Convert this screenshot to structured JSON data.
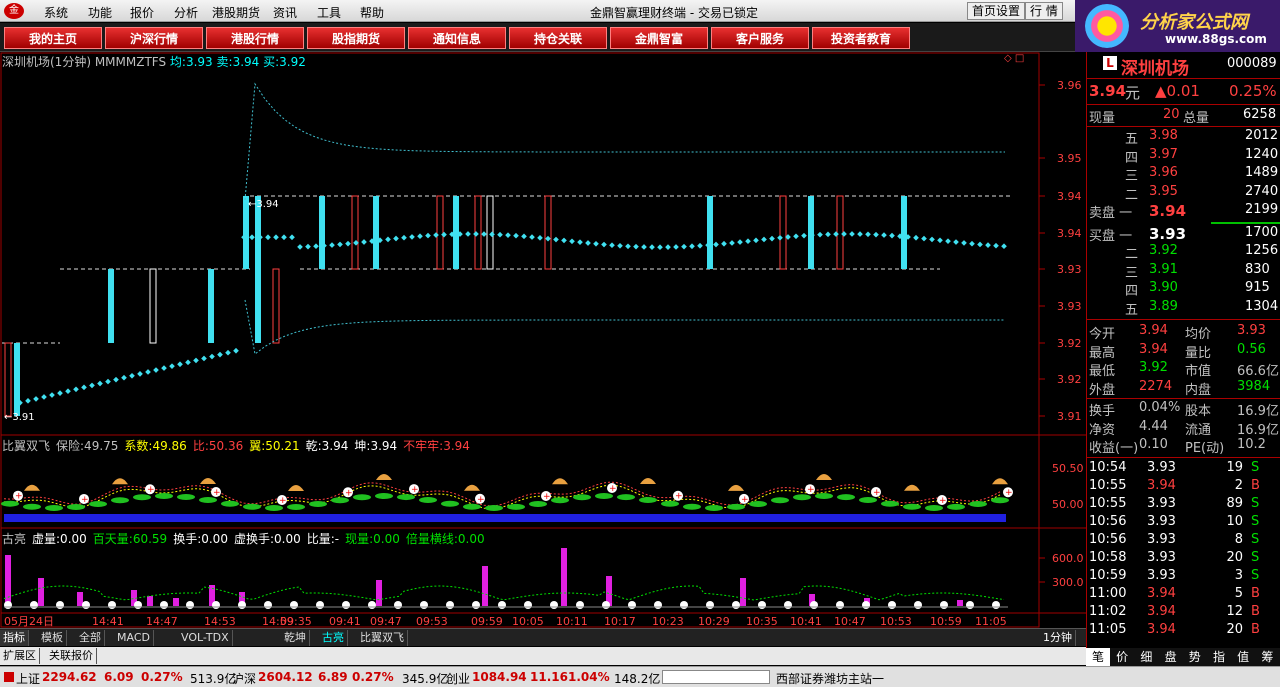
{
  "menu": {
    "items": [
      "系统",
      "功能",
      "报价",
      "分析",
      "港股期货",
      "资讯",
      "工具",
      "帮助"
    ],
    "title": "金鼎智赢理财终端 - 交易已锁定",
    "btn_home": "首页设置",
    "btn_quote": "行 情"
  },
  "ad": {
    "title": "分析家公式网",
    "url": "www.88gs.com"
  },
  "tabs": [
    "我的主页",
    "沪深行情",
    "港股行情",
    "股指期货",
    "通知信息",
    "持仓关联",
    "金鼎智富",
    "客户服务",
    "投资者教育"
  ],
  "chart_header": {
    "name": "深圳机场(1分钟) MMMMZTFS",
    "avg_label": "均:",
    "avg": "3.93",
    "sell_label": "卖:",
    "sell": "3.94",
    "buy_label": "买:",
    "buy": "3.92"
  },
  "price_axis": [
    "3.96",
    "3.95",
    "3.94",
    "3.94",
    "3.93",
    "3.93",
    "3.92",
    "3.92",
    "3.91"
  ],
  "annotations": {
    "high": "3.94",
    "low": "3.91"
  },
  "ind1": {
    "name": "比翼双飞",
    "items": [
      {
        "label": "保险:",
        "value": "49.75",
        "color": "#c0c0c0"
      },
      {
        "label": "系数:",
        "value": "49.86",
        "color": "#ffff00"
      },
      {
        "label": "比:",
        "value": "50.36",
        "color": "#ff4040"
      },
      {
        "label": "翼:",
        "value": "50.21",
        "color": "#ffff00"
      },
      {
        "label": "乾:",
        "value": "3.94",
        "color": "#fff"
      },
      {
        "label": "坤:",
        "value": "3.94",
        "color": "#fff"
      },
      {
        "label": "不牢牢:",
        "value": "3.94",
        "color": "#ff4040"
      }
    ],
    "axis": [
      "50.50",
      "50.00"
    ]
  },
  "ind2": {
    "name": "古亮",
    "items": [
      {
        "label": "虚量:",
        "value": "0.00",
        "color": "#fff"
      },
      {
        "label": "百天量:",
        "value": "60.59",
        "color": "#00e000"
      },
      {
        "label": "换手:",
        "value": "0.00",
        "color": "#fff"
      },
      {
        "label": "虚换手:",
        "value": "0.00",
        "color": "#fff"
      },
      {
        "label": "比量:",
        "value": "-",
        "color": "#fff"
      },
      {
        "label": "现量:",
        "value": "0.00",
        "color": "#00e000"
      },
      {
        "label": "倍量横线:",
        "value": "0.00",
        "color": "#00e000"
      }
    ],
    "axis": [
      "600.0",
      "300.0"
    ]
  },
  "time_axis": [
    "05月24日",
    "14:41",
    "14:47",
    "14:53",
    "14:59",
    "09:35",
    "09:41",
    "09:47",
    "09:53",
    "09:59",
    "10:05",
    "10:11",
    "10:17",
    "10:23",
    "10:29",
    "10:35",
    "10:41",
    "10:47",
    "10:53",
    "10:59",
    "11:05"
  ],
  "period": "1分钟",
  "bottom_tabs": [
    "指标",
    "模板",
    "全部",
    "MACD",
    "VOL-TDX",
    "乾坤",
    "古亮",
    "比翼双飞"
  ],
  "extra_tabs": [
    "扩展区",
    "关联报价"
  ],
  "stock": {
    "name": "深圳机场",
    "code": "000089",
    "price": "3.94",
    "unit": "元",
    "change": "▲0.01",
    "pct": "0.25%"
  },
  "vol": {
    "l1": "现量",
    "v1": "20",
    "l2": "总量",
    "v2": "6258"
  },
  "sell": [
    {
      "l": "五",
      "p": "3.98",
      "v": "2012"
    },
    {
      "l": "四",
      "p": "3.97",
      "v": "1240"
    },
    {
      "l": "三",
      "p": "3.96",
      "v": "1489"
    },
    {
      "l": "二",
      "p": "3.95",
      "v": "2740"
    },
    {
      "l": "卖盘 一",
      "p": "3.94",
      "v": "2199"
    }
  ],
  "buy": [
    {
      "l": "买盘 一",
      "p": "3.93",
      "v": "1700"
    },
    {
      "l": "二",
      "p": "3.92",
      "v": "1256"
    },
    {
      "l": "三",
      "p": "3.91",
      "v": "830"
    },
    {
      "l": "四",
      "p": "3.90",
      "v": "915"
    },
    {
      "l": "五",
      "p": "3.89",
      "v": "1304"
    }
  ],
  "stats": [
    {
      "l1": "今开",
      "v1": "3.94",
      "c1": "red",
      "l2": "均价",
      "v2": "3.93",
      "c2": "red"
    },
    {
      "l1": "最高",
      "v1": "3.94",
      "c1": "red",
      "l2": "量比",
      "v2": "0.56",
      "c2": "grn"
    },
    {
      "l1": "最低",
      "v1": "3.92",
      "c1": "grn",
      "l2": "市值",
      "v2": "66.6亿",
      "c2": "gry"
    },
    {
      "l1": "外盘",
      "v1": "2274",
      "c1": "red",
      "l2": "内盘",
      "v2": "3984",
      "c2": "grn"
    },
    {
      "l1": "换手",
      "v1": "0.04%",
      "c1": "gry",
      "l2": "股本",
      "v2": "16.9亿",
      "c2": "gry"
    },
    {
      "l1": "净资",
      "v1": "4.44",
      "c1": "gry",
      "l2": "流通",
      "v2": "16.9亿",
      "c2": "gry"
    },
    {
      "l1": "收益(一)",
      "v1": "0.10",
      "c1": "gry",
      "l2": "PE(动)",
      "v2": "10.2",
      "c2": "gry"
    }
  ],
  "ticks": [
    {
      "t": "10:54",
      "p": "3.93",
      "c": "wht",
      "v": "19",
      "s": "S"
    },
    {
      "t": "10:55",
      "p": "3.94",
      "c": "red",
      "v": "2",
      "s": "B"
    },
    {
      "t": "10:55",
      "p": "3.93",
      "c": "wht",
      "v": "89",
      "s": "S"
    },
    {
      "t": "10:56",
      "p": "3.93",
      "c": "wht",
      "v": "10",
      "s": "S"
    },
    {
      "t": "10:56",
      "p": "3.93",
      "c": "wht",
      "v": "8",
      "s": "S"
    },
    {
      "t": "10:58",
      "p": "3.93",
      "c": "wht",
      "v": "20",
      "s": "S"
    },
    {
      "t": "10:59",
      "p": "3.93",
      "c": "wht",
      "v": "3",
      "s": "S"
    },
    {
      "t": "11:00",
      "p": "3.94",
      "c": "red",
      "v": "5",
      "s": "B"
    },
    {
      "t": "11:02",
      "p": "3.94",
      "c": "red",
      "v": "12",
      "s": "B"
    },
    {
      "t": "11:05",
      "p": "3.94",
      "c": "red",
      "v": "20",
      "s": "B"
    }
  ],
  "right_tabs": [
    "笔",
    "价",
    "细",
    "盘",
    "势",
    "指",
    "值",
    "筹"
  ],
  "status": {
    "sh_label": "上证",
    "sh": "2294.62",
    "sh_chg": "6.09",
    "sh_pct": "0.27%",
    "sh_amt": "513.9亿",
    "sz_label": "沪深",
    "sz": "2604.12",
    "sz_chg": "6.89",
    "sz_pct": "0.27%",
    "sz_amt": "345.9亿",
    "cy_label": "创业",
    "cy": "1084.94",
    "cy_chg": "11.16",
    "cy_pct": "1.04%",
    "cy_amt": "148.2亿",
    "site": "西部证券潍坊主站一"
  },
  "colors": {
    "up": "#ff4040",
    "down": "#00e000",
    "cyan": "#40e0f0"
  }
}
